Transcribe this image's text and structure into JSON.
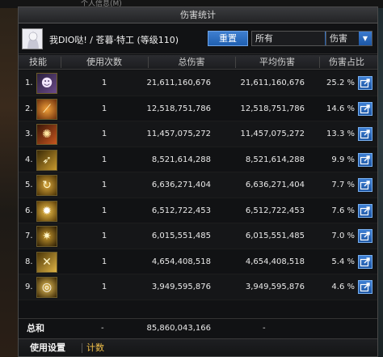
{
  "background": {
    "top_text": "个人信息(M)"
  },
  "window": {
    "title": "伤害统计"
  },
  "header": {
    "player_name": "我DIO哒! / 苍暮·特工 (等级110)",
    "reset_label": "重置",
    "filter_value": "所有",
    "type_value": "伤害"
  },
  "columns": {
    "skill": "技能",
    "uses": "使用次数",
    "total": "总伤害",
    "avg": "平均伤害",
    "pct": "伤害占比"
  },
  "rows": [
    {
      "rank": "1.",
      "icon": "character-portrait-icon",
      "uses": "1",
      "total": "21,611,160,676",
      "avg": "21,611,160,676",
      "pct": "25.2 %"
    },
    {
      "rank": "2.",
      "icon": "slash-skill-icon",
      "uses": "1",
      "total": "12,518,751,786",
      "avg": "12,518,751,786",
      "pct": "14.6 %"
    },
    {
      "rank": "3.",
      "icon": "fire-skill-icon",
      "uses": "1",
      "total": "11,457,075,272",
      "avg": "11,457,075,272",
      "pct": "13.3 %"
    },
    {
      "rank": "4.",
      "icon": "dash-skill-icon",
      "uses": "1",
      "total": "8,521,614,288",
      "avg": "8,521,614,288",
      "pct": "9.9 %"
    },
    {
      "rank": "5.",
      "icon": "spin-skill-icon",
      "uses": "1",
      "total": "6,636,271,404",
      "avg": "6,636,271,404",
      "pct": "7.7 %"
    },
    {
      "rank": "6.",
      "icon": "burst-skill-icon",
      "uses": "1",
      "total": "6,512,722,453",
      "avg": "6,512,722,453",
      "pct": "7.6 %"
    },
    {
      "rank": "7.",
      "icon": "radial-skill-icon",
      "uses": "1",
      "total": "6,015,551,485",
      "avg": "6,015,551,485",
      "pct": "7.0 %"
    },
    {
      "rank": "8.",
      "icon": "cross-blade-skill-icon",
      "uses": "1",
      "total": "4,654,408,518",
      "avg": "4,654,408,518",
      "pct": "5.4 %"
    },
    {
      "rank": "9.",
      "icon": "ring-skill-icon",
      "uses": "1",
      "total": "3,949,595,876",
      "avg": "3,949,595,876",
      "pct": "4.6 %"
    }
  ],
  "totals": {
    "label": "总和",
    "uses": "-",
    "total": "85,860,043,166",
    "avg": "-"
  },
  "footer": {
    "settings_label": "使用设置",
    "count_label": "计数"
  },
  "colors": {
    "accent": "#2f6fc4",
    "footer_highlight": "#f2c04a",
    "icon_gold": "#c99a2e"
  }
}
